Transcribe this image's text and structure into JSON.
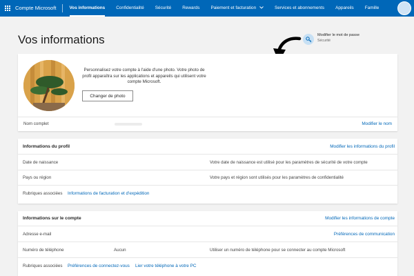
{
  "topbar": {
    "brand": "Compte Microsoft",
    "nav": [
      "Vos informations",
      "Confidentialité",
      "Sécurité",
      "Rewards",
      "Paiement et facturation",
      "Services et abonnements",
      "Appareils",
      "Famille"
    ],
    "chevron": "chevron-down-icon"
  },
  "page": {
    "title": "Vos informations"
  },
  "password": {
    "title": "Modifier le mot de passe",
    "subtitle": "Sécurité",
    "icon": "key-icon"
  },
  "photo_card": {
    "description": "Personnalisez votre compte à l'aide d'une photo. Votre photo de profil apparaîtra sur les applications et appareils qui utilisent votre compte Microsoft.",
    "change_photo": "Changer de photo",
    "full_name_label": "Nom complet",
    "edit_name": "Modifier le nom"
  },
  "profile_card": {
    "title": "Informations du profil",
    "edit": "Modifier les informations du profil",
    "birth_label": "Date de naissance",
    "birth_desc": "Votre date de naissance est utilisé pour les paramètres de sécurité de votre compte",
    "country_label": "Pays ou région",
    "country_desc": "Votre pays et région sont utilisés pour les paramètres de confidentialité",
    "related_label": "Rubriques associées",
    "related_link": "Informations de facturation et d'expédition"
  },
  "account_card": {
    "title": "Informations sur le compte",
    "edit": "Modifier les informations de compte",
    "email_label": "Adresse e-mail",
    "comm_prefs": "Préférences de communication",
    "phone_label": "Numéro de téléphone",
    "phone_value": "Aucun",
    "phone_desc": "Utiliser un numéro de téléphone pour se connecter au compte Microsoft",
    "related_label": "Rubriques associées",
    "related_link1": "Préférences de connectez-vous",
    "related_link2": "Lier votre téléphone à votre PC"
  },
  "colors": {
    "accent": "#0067b8",
    "background": "#f2f2f2"
  }
}
